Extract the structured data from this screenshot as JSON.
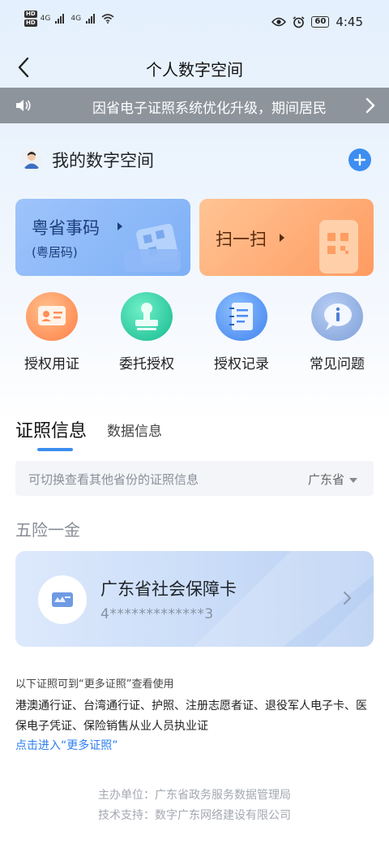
{
  "status_bar": {
    "hd_1": "HD",
    "hd_2": "HD",
    "net_1": "4G",
    "net_2": "4G",
    "battery": "60",
    "time": "4:45"
  },
  "nav": {
    "title": "个人数字空间"
  },
  "notice": {
    "text": "因省电子证照系统优化升级，期间居民"
  },
  "my_space": {
    "title": "我的数字空间"
  },
  "cards": {
    "code_title": "粤省事码",
    "code_subtitle": "(粤居码)",
    "scan_title": "扫一扫"
  },
  "shortcuts": [
    {
      "label": "授权用证",
      "icon": "id-card-icon",
      "color": "#ff8f55"
    },
    {
      "label": "委托授权",
      "icon": "stamp-icon",
      "color": "#2ecfa3"
    },
    {
      "label": "授权记录",
      "icon": "notebook-icon",
      "color": "#4a8df5"
    },
    {
      "label": "常见问题",
      "icon": "info-bubble-icon",
      "color": "#4f7fd6"
    }
  ],
  "tabs": {
    "active": "证照信息",
    "other": "数据信息"
  },
  "province": {
    "hint": "可切换查看其他省份的证照信息",
    "selected": "广东省"
  },
  "section": {
    "label": "五险一金"
  },
  "social_card": {
    "name": "广东省社会保障卡",
    "number": "4*************3"
  },
  "more": {
    "note": "以下证照可到“更多证照”查看使用",
    "list": "港澳通行证、台湾通行证、护照、注册志愿者证、退役军人电子卡、医保电子凭证、保险销售从业人员执业证",
    "link": "点击进入“更多证照”"
  },
  "footer": {
    "organizer": "主办单位：广东省政务服务数据管理局",
    "support": "技术支持：数字广东网络建设有限公司"
  },
  "colors": {
    "accent": "#3d8ef0",
    "notice_bg": "#8e949c",
    "link": "#2f7ff0"
  }
}
